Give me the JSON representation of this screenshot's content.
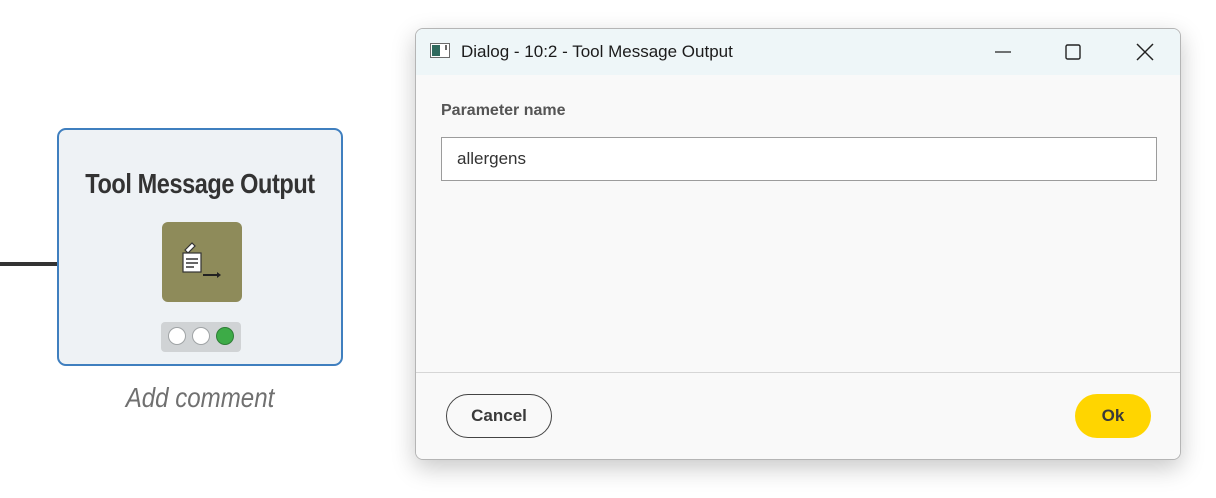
{
  "canvas": {
    "node": {
      "title": "Tool Message Output",
      "icon": "tool-message-output-icon",
      "icon_color": "#8e8b5a",
      "status_lights": [
        "inactive",
        "inactive",
        "green"
      ],
      "status_color": "#3dab47",
      "border_color": "#3f7fbf",
      "add_comment": "Add comment"
    }
  },
  "dialog": {
    "title": "Dialog - 10:2 - Tool Message Output",
    "window_controls": [
      "minimize-icon",
      "maximize-icon",
      "close-icon"
    ],
    "parameter_label": "Parameter name",
    "parameter_value": "allergens",
    "cancel_label": "Cancel",
    "ok_label": "Ok",
    "ok_color": "#ffd500"
  }
}
